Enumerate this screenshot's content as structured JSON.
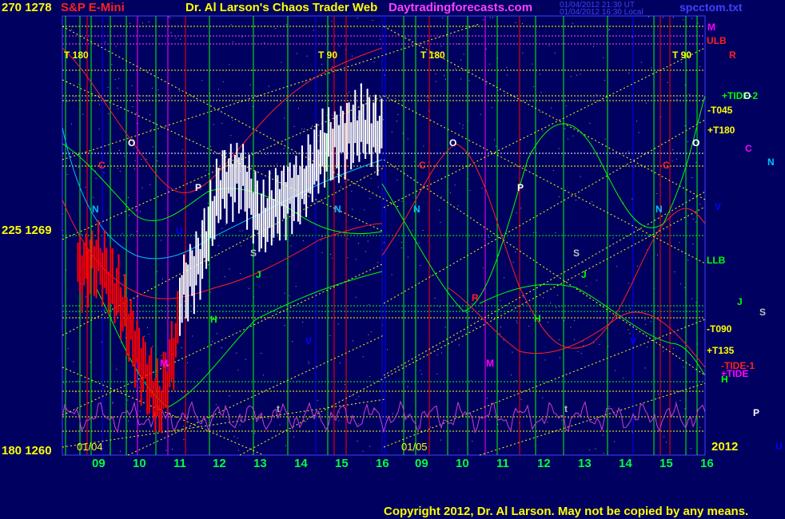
{
  "header": {
    "left_price_high": "270  1278",
    "symbol": "S&P E-Mini",
    "title": "Dr. Al Larson's Chaos Trader Web",
    "site": "Daytradingforecasts.com",
    "timestamp_ut": "01/04/2012 21:30 UT",
    "timestamp_local": "01/04/2012 16:30 Local",
    "file": "spcctom.txt"
  },
  "colors": {
    "background": "#000060",
    "price_bars_red": "#ff0000",
    "price_bars_white": "#ffffff",
    "grid_green": "#00ff40",
    "grid_blue": "#0000ff",
    "grid_yellow": "#ffff00",
    "grid_magenta": "#ff00ff",
    "oscillator": "#cc40cc"
  },
  "y_axis": {
    "top": "270  1278",
    "middle": "225  1269",
    "bottom": "180  1260"
  },
  "x_axis": {
    "dates": [
      "01/04",
      "01/05"
    ],
    "year": "2012",
    "hours": [
      "09",
      "10",
      "11",
      "12",
      "13",
      "14",
      "15",
      "16",
      "09",
      "10",
      "11",
      "12",
      "13",
      "14",
      "15",
      "16"
    ]
  },
  "top_markers": [
    "T  180",
    "T  90",
    "T  180",
    "T  90"
  ],
  "right_labels": [
    {
      "text": "M",
      "color": "#ff00ff"
    },
    {
      "text": "ULB",
      "color": "#ff2020"
    },
    {
      "text": "R",
      "color": "#ff2020"
    },
    {
      "text": "+TIDE-2",
      "color": "#00ff00"
    },
    {
      "text": "O",
      "color": "#ffffff"
    },
    {
      "text": "-T045",
      "color": "#ffff00"
    },
    {
      "text": "+T180",
      "color": "#ffff00"
    },
    {
      "text": "O",
      "color": "#ffffff"
    },
    {
      "text": "C",
      "color": "#ff00ff"
    },
    {
      "text": "N",
      "color": "#00c0ff"
    },
    {
      "text": "V",
      "color": "#0000ff"
    },
    {
      "text": "LLB",
      "color": "#00ff00"
    },
    {
      "text": "J",
      "color": "#00ff00"
    },
    {
      "text": "S",
      "color": "#c0c0c0"
    },
    {
      "text": "-T090",
      "color": "#ffff00"
    },
    {
      "text": "+T135",
      "color": "#ffff00"
    },
    {
      "text": "-TIDE-1",
      "color": "#ff2020"
    },
    {
      "text": "+TIDE",
      "color": "#ff00ff"
    },
    {
      "text": "H",
      "color": "#00ff00"
    },
    {
      "text": "P",
      "color": "#ffffff"
    },
    {
      "text": "U",
      "color": "#0000ff"
    }
  ],
  "in_chart_labels": [
    {
      "text": "O",
      "color": "#ffffff"
    },
    {
      "text": "C",
      "color": "#ff2020"
    },
    {
      "text": "N",
      "color": "#00c0ff"
    },
    {
      "text": "P",
      "color": "#ffffff"
    },
    {
      "text": "U",
      "color": "#0000ff"
    },
    {
      "text": "S",
      "color": "#c0c0c0"
    },
    {
      "text": "J",
      "color": "#00ff00"
    },
    {
      "text": "H",
      "color": "#00ff00"
    },
    {
      "text": "V",
      "color": "#0000ff"
    },
    {
      "text": "M",
      "color": "#ff00ff"
    },
    {
      "text": "N",
      "color": "#00c0ff"
    },
    {
      "text": "O",
      "color": "#ffffff"
    },
    {
      "text": "C",
      "color": "#ff2020"
    },
    {
      "text": "N",
      "color": "#00c0ff"
    },
    {
      "text": "P",
      "color": "#ffffff"
    },
    {
      "text": "S",
      "color": "#c0c0c0"
    },
    {
      "text": "J",
      "color": "#00ff00"
    },
    {
      "text": "R",
      "color": "#ff2020"
    },
    {
      "text": "H",
      "color": "#00ff00"
    },
    {
      "text": "M",
      "color": "#ff00ff"
    },
    {
      "text": "V",
      "color": "#0000ff"
    },
    {
      "text": "N",
      "color": "#00c0ff"
    },
    {
      "text": "C",
      "color": "#ff2020"
    },
    {
      "text": "O",
      "color": "#ffffff"
    },
    {
      "text": "t",
      "color": "#c0c0c0"
    },
    {
      "text": "t",
      "color": "#c0c0c0"
    }
  ],
  "copyright": "Copyright 2012, Dr. Al Larson. May not be copied by any means.",
  "chart_data": {
    "type": "line",
    "title": "S&P E-Mini",
    "instrument": "S&P E-Mini",
    "ylim": [
      1260,
      1278
    ],
    "ylabel_pairs": [
      [
        270,
        1278
      ],
      [
        225,
        1269
      ],
      [
        180,
        1260
      ]
    ],
    "x_categories": [
      "09",
      "10",
      "11",
      "12",
      "13",
      "14",
      "15",
      "16",
      "09",
      "10",
      "11",
      "12",
      "13",
      "14",
      "15",
      "16"
    ],
    "series": [
      {
        "color": "#ff0000",
        "x": [
          "08:30",
          "09:00",
          "09:30",
          "10:00",
          "10:30",
          "10:45",
          "11:00"
        ],
        "values": [
          1267.5,
          1268.0,
          1266.5,
          1264.0,
          1262.0,
          1263.5,
          1265.5
        ]
      },
      {
        "color": "#ffffff",
        "x": [
          "11:00",
          "11:30",
          "12:00",
          "12:30",
          "13:00",
          "13:30",
          "14:00",
          "14:30",
          "15:00",
          "15:30",
          "16:00"
        ],
        "values": [
          1266.5,
          1268.0,
          1271.0,
          1271.5,
          1269.5,
          1270.5,
          1271.0,
          1272.5,
          1273.0,
          1273.5,
          1273.0
        ]
      }
    ]
  }
}
